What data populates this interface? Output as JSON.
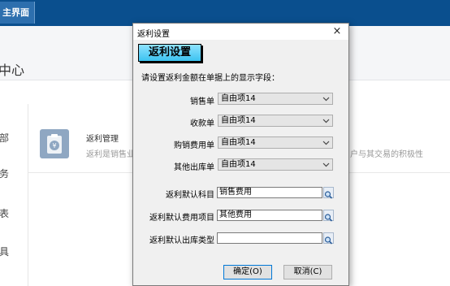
{
  "app": {
    "tab_title": "主界面",
    "header_title": "中心",
    "sidebar_items": [
      "部",
      "务",
      "表",
      "具"
    ],
    "module": {
      "title": "返利管理",
      "desc_left": "返利是销售业",
      "desc_right": "户与其交易的积极性"
    }
  },
  "dialog": {
    "title": "返利设置",
    "close_glyph": "×",
    "heading": "返利设置",
    "instruction": "请设置返利金额在单据上的显示字段：",
    "combo_rows": [
      {
        "label": "销售单",
        "value": "自由项14"
      },
      {
        "label": "收款单",
        "value": "自由项14"
      },
      {
        "label": "购销费用单",
        "value": "自由项14"
      },
      {
        "label": "其他出库单",
        "value": "自由项14"
      }
    ],
    "lookup_rows": [
      {
        "label": "返利默认科目",
        "value": "销售费用"
      },
      {
        "label": "返利默认费用项目",
        "value": "其他费用"
      },
      {
        "label": "返利默认出库类型",
        "value": ""
      }
    ],
    "ok_label": "确定(O)",
    "cancel_label": "取消(C)"
  },
  "colors": {
    "topbar": "#0a4f8e",
    "heading_bg": "#3cc3f0",
    "dialog_bg": "#f0f0f0"
  },
  "icons": {
    "close": "close-icon",
    "dropdown": "chevron-down-icon",
    "lookup": "search-icon",
    "module": "rebate-icon"
  }
}
